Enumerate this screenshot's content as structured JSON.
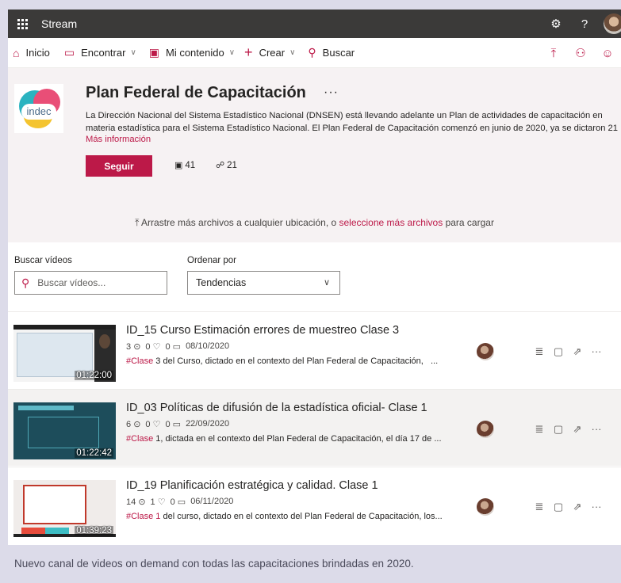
{
  "topbar": {
    "app_title": "Stream",
    "help_label": "?"
  },
  "nav": {
    "home": "Inicio",
    "discover": "Encontrar",
    "my_content": "Mi contenido",
    "create": "Crear",
    "search": "Buscar"
  },
  "channel": {
    "title": "Plan Federal de Capacitación",
    "more": "···",
    "logo_text": "indec",
    "description_line1": "La Dirección Nacional del Sistema Estadístico Nacional (DNSEN) está llevando adelante un Plan de actividades de capacitación en",
    "description_line2": "materia estadística para el Sistema Estadístico Nacional. El Plan Federal de Capacitación comenzó en junio de 2020, ya se dictaron 21",
    "more_info": "Más información",
    "follow_label": "Seguir",
    "videos_count": "41",
    "followers_count": "21"
  },
  "upload": {
    "prefix": "Arrastre más archivos a cualquier ubicación, o ",
    "link": "seleccione más archivos",
    "suffix": " para cargar"
  },
  "filters": {
    "search_label": "Buscar vídeos",
    "search_placeholder": "Buscar vídeos...",
    "sort_label": "Ordenar por",
    "sort_value": "Tendencias"
  },
  "videos": [
    {
      "title": "ID_15 Curso Estimación errores de muestreo Clase 3",
      "views": "3",
      "likes": "0",
      "comments": "0",
      "date": "08/10/2020",
      "tag": "#Clase",
      "desc": " 3 del Curso, dictado en el contexto del Plan Federal de Capacitación,",
      "duration": "01:22:00"
    },
    {
      "title": "ID_03 Políticas de difusión de la estadística oficial- Clase 1",
      "views": "6",
      "likes": "0",
      "comments": "0",
      "date": "22/09/2020",
      "tag": "#Clase",
      "desc": " 1, dictada en el contexto del Plan Federal de Capacitación, el día 17 de",
      "duration": "01:22:42"
    },
    {
      "title": "ID_19 Planificación estratégica y calidad. Clase 1",
      "views": "14",
      "likes": "1",
      "comments": "0",
      "date": "06/11/2020",
      "tag": "#Clase 1",
      "desc": " del curso, dictado en el contexto del Plan Federal de Capacitación, los",
      "duration": "01:39:23"
    }
  ],
  "ellipsis": "...",
  "caption": "Nuevo canal de videos on demand con todas las capacitaciones brindadas en 2020."
}
